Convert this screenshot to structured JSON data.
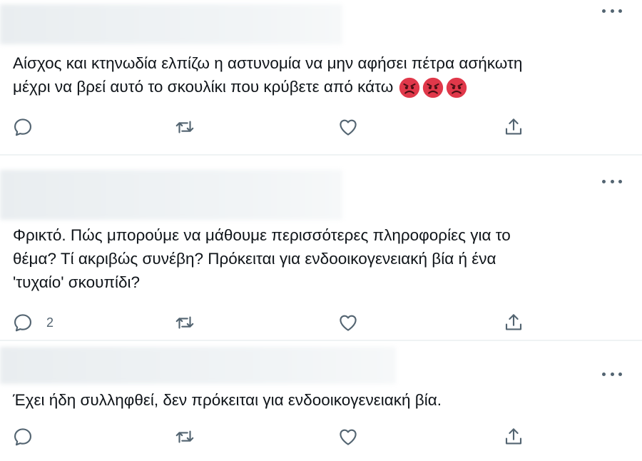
{
  "tweets": [
    {
      "text": "Αίσχος και κτηνωδία ελπίζω η αστυνομία να μην αφήσει πέτρα ασήκωτη\nμέχρι να βρεί αυτό το σκουλίκι που κρύβετε από κάτω",
      "emojis": [
        "angry-face-emoji",
        "angry-face-emoji",
        "angry-face-emoji"
      ],
      "reply_count": ""
    },
    {
      "text": "Φρικτό. Πώς μπορούμε να μάθουμε περισσότερες πληροφορίες για το\nθέμα? Τί ακριβώς συνέβη? Πρόκειται για ενδοοικογενειακή βία ή ένα\n'τυχαίο' σκουπίδι?",
      "emojis": [],
      "reply_count": "2"
    },
    {
      "text": "Έχει ήδη συλληφθεί, δεν πρόκειται για ενδοοικογενειακή βία.",
      "emojis": [],
      "reply_count": ""
    }
  ],
  "icons": {
    "reply": "reply-icon",
    "retweet": "retweet-icon",
    "like": "heart-icon",
    "share": "share-icon",
    "more": "more-options-icon"
  },
  "colors": {
    "text": "#0f1419",
    "icon": "#536471",
    "divider": "#eff3f4",
    "emoji_red": "#e0384a"
  }
}
